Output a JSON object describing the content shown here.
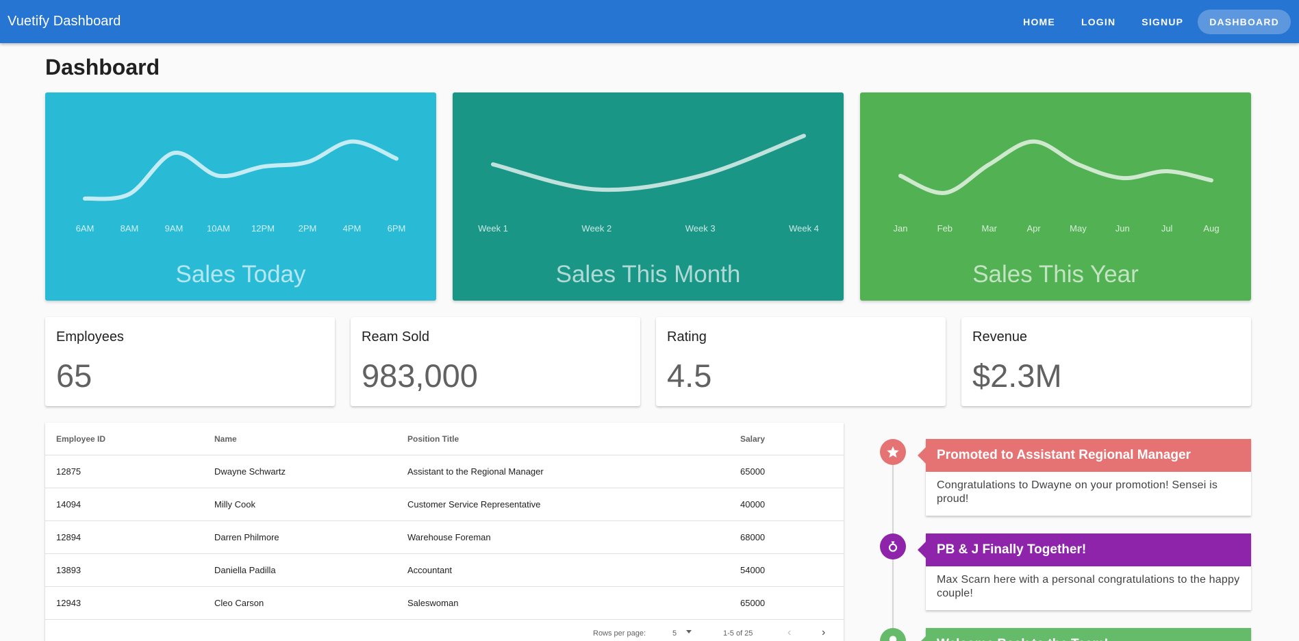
{
  "app": {
    "title": "Vuetify Dashboard"
  },
  "nav": {
    "items": [
      "HOME",
      "LOGIN",
      "SIGNUP",
      "DASHBOARD"
    ],
    "active": "DASHBOARD"
  },
  "page_title": "Dashboard",
  "colors": {
    "appbar": "#2775d3",
    "today": "#29bad6",
    "month": "#1a9687",
    "year": "#52b152",
    "red": "#e57373",
    "purple": "#8e24aa",
    "green": "#66bb6a"
  },
  "chart_data": [
    {
      "type": "line",
      "title": "Sales Today",
      "categories": [
        "6AM",
        "8AM",
        "9AM",
        "10AM",
        "12PM",
        "2PM",
        "4PM",
        "6PM"
      ],
      "values": [
        0,
        4,
        40,
        20,
        28,
        32,
        50,
        35
      ],
      "ylim": [
        0,
        60
      ],
      "grid": false
    },
    {
      "type": "line",
      "title": "Sales This Month",
      "categories": [
        "Week 1",
        "Week 2",
        "Week 3",
        "Week 4"
      ],
      "values": [
        30,
        8,
        20,
        55
      ],
      "ylim": [
        0,
        60
      ],
      "grid": false
    },
    {
      "type": "line",
      "title": "Sales This Year",
      "categories": [
        "Jan",
        "Feb",
        "Mar",
        "Apr",
        "May",
        "Jun",
        "Jul",
        "Aug"
      ],
      "values": [
        20,
        5,
        30,
        50,
        30,
        18,
        24,
        16
      ],
      "ylim": [
        0,
        60
      ],
      "grid": false
    }
  ],
  "stats": [
    {
      "label": "Employees",
      "value": "65"
    },
    {
      "label": "Ream Sold",
      "value": "983,000"
    },
    {
      "label": "Rating",
      "value": "4.5"
    },
    {
      "label": "Revenue",
      "value": "$2.3M"
    }
  ],
  "table": {
    "headers": [
      "Employee ID",
      "Name",
      "Position Title",
      "Salary"
    ],
    "rows": [
      [
        "12875",
        "Dwayne Schwartz",
        "Assistant to the Regional Manager",
        "65000"
      ],
      [
        "14094",
        "Milly Cook",
        "Customer Service Representative",
        "40000"
      ],
      [
        "12894",
        "Darren Philmore",
        "Warehouse Foreman",
        "68000"
      ],
      [
        "13893",
        "Daniella Padilla",
        "Accountant",
        "54000"
      ],
      [
        "12943",
        "Cleo Carson",
        "Saleswoman",
        "65000"
      ]
    ],
    "footer": {
      "rows_label": "Rows per page:",
      "rows_value": "5",
      "range": "1-5 of 25"
    }
  },
  "timeline": [
    {
      "icon": "star-icon",
      "title": "Promoted to Assistant Regional Manager",
      "body": "Congratulations to Dwayne on your promotion! Sensei is proud!",
      "color": "#e57373"
    },
    {
      "icon": "ring-icon",
      "title": "PB & J Finally Together!",
      "body": "Max Scarn here with a personal congratulations to the happy couple!",
      "color": "#8e24aa"
    },
    {
      "icon": "map-marker-icon",
      "title": "Welcome Back to the Team!",
      "body": "",
      "color": "#66bb6a"
    }
  ]
}
